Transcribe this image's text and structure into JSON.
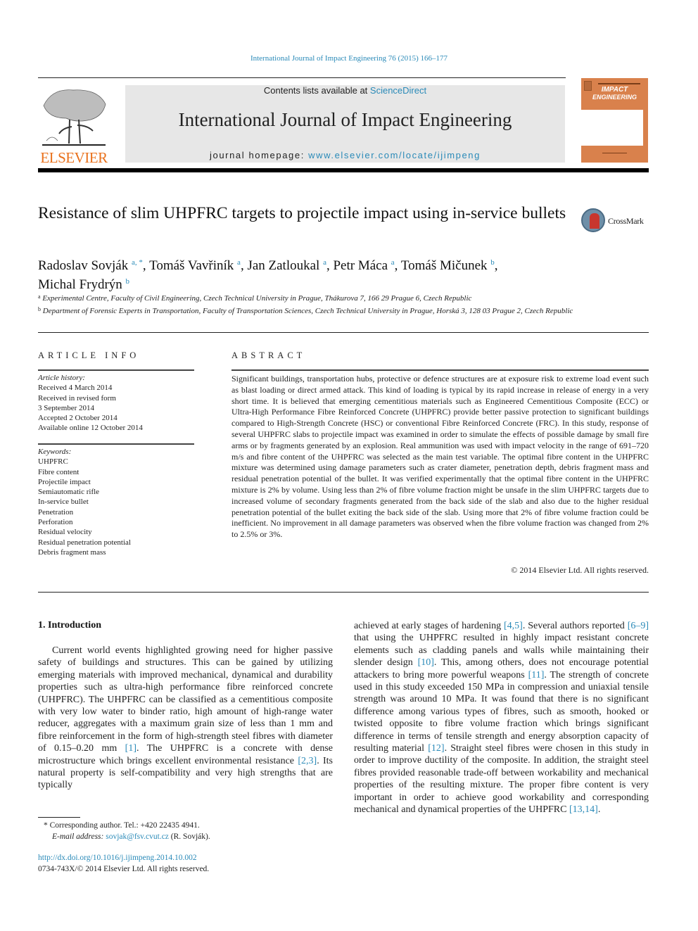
{
  "header": {
    "citation": "International Journal of Impact Engineering 76 (2015) 166–177",
    "publisher_logo_text": "ELSEVIER",
    "contents_prefix": "Contents lists available at ",
    "contents_link": "ScienceDirect",
    "journal_title": "International Journal of Impact Engineering",
    "homepage_prefix": "journal homepage: ",
    "homepage_link": "www.elsevier.com/locate/ijimpeng",
    "cover_title_1": "IMPACT",
    "cover_title_2": "ENGINEERING",
    "crossmark_label": "CrossMark"
  },
  "article": {
    "title": "Resistance of slim UHPFRC targets to projectile impact using in-service bullets",
    "authors": [
      {
        "name": "Radoslav Sovják",
        "aff": "a, *"
      },
      {
        "name": "Tomáš Vavřiník",
        "aff": "a"
      },
      {
        "name": "Jan Zatloukal",
        "aff": "a"
      },
      {
        "name": "Petr Máca",
        "aff": "a"
      },
      {
        "name": "Tomáš Mičunek",
        "aff": "b"
      },
      {
        "name": "Michal Frydrýn",
        "aff": "b"
      }
    ],
    "affiliations": [
      {
        "mark": "a",
        "text": "Experimental Centre, Faculty of Civil Engineering, Czech Technical University in Prague, Thákurova 7, 166 29 Prague 6, Czech Republic"
      },
      {
        "mark": "b",
        "text": "Department of Forensic Experts in Transportation, Faculty of Transportation Sciences, Czech Technical University in Prague, Horská 3, 128 03 Prague 2, Czech Republic"
      }
    ]
  },
  "article_info": {
    "heading": "ARTICLE INFO",
    "history_label": "Article history:",
    "history": [
      "Received 4 March 2014",
      "Received in revised form",
      "3 September 2014",
      "Accepted 2 October 2014",
      "Available online 12 October 2014"
    ],
    "keywords_label": "Keywords:",
    "keywords": [
      "UHPFRC",
      "Fibre content",
      "Projectile impact",
      "Semiautomatic rifle",
      "In-service bullet",
      "Penetration",
      "Perforation",
      "Residual velocity",
      "Residual penetration potential",
      "Debris fragment mass"
    ]
  },
  "abstract": {
    "heading": "ABSTRACT",
    "text": "Significant buildings, transportation hubs, protective or defence structures are at exposure risk to extreme load event such as blast loading or direct armed attack. This kind of loading is typical by its rapid increase in release of energy in a very short time. It is believed that emerging cementitious materials such as Engineered Cementitious Composite (ECC) or Ultra-High Performance Fibre Reinforced Concrete (UHPFRC) provide better passive protection to significant buildings compared to High-Strength Concrete (HSC) or conventional Fibre Reinforced Concrete (FRC). In this study, response of several UHPFRC slabs to projectile impact was examined in order to simulate the effects of possible damage by small fire arms or by fragments generated by an explosion. Real ammunition was used with impact velocity in the range of 691–720 m/s and fibre content of the UHPFRC was selected as the main test variable. The optimal fibre content in the UHPFRC mixture was determined using damage parameters such as crater diameter, penetration depth, debris fragment mass and residual penetration potential of the bullet. It was verified experimentally that the optimal fibre content in the UHPFRC mixture is 2% by volume. Using less than 2% of fibre volume fraction might be unsafe in the slim UHPFRC targets due to increased volume of secondary fragments generated from the back side of the slab and also due to the higher residual penetration potential of the bullet exiting the back side of the slab. Using more that 2% of fibre volume fraction could be inefficient. No improvement in all damage parameters was observed when the fibre volume fraction was changed from 2% to 2.5% or 3%.",
    "copyright": "© 2014 Elsevier Ltd. All rights reserved."
  },
  "intro": {
    "heading": "1.  Introduction",
    "left": [
      {
        "t": "Current world events highlighted growing need for higher passive safety of buildings and structures. This can be gained by utilizing emerging materials with improved mechanical, dynamical and durability properties such as ultra-high performance fibre reinforced concrete (UHPFRC). The UHPFRC can be classified as a cementitious composite with very low water to binder ratio, high amount of high-range water reducer, aggregates with a maximum grain size of less than 1 mm and fibre reinforcement in the form of high-strength steel fibres with diameter of 0.15–0.20 mm "
      },
      {
        "ref": "[1]"
      },
      {
        "t": ". The UHPFRC is a concrete with dense microstructure which brings excellent environmental resistance "
      },
      {
        "ref": "[2,3]"
      },
      {
        "t": ". Its natural property is self-compatibility and very high strengths that are typically"
      }
    ],
    "right": [
      {
        "t": "achieved at early stages of hardening "
      },
      {
        "ref": "[4,5]"
      },
      {
        "t": ". Several authors reported "
      },
      {
        "ref": "[6–9]"
      },
      {
        "t": " that using the UHPFRC resulted in highly impact resistant concrete elements such as cladding panels and walls while maintaining their slender design "
      },
      {
        "ref": "[10]"
      },
      {
        "t": ". This, among others, does not encourage potential attackers to bring more powerful weapons "
      },
      {
        "ref": "[11]"
      },
      {
        "t": ". The strength of concrete used in this study exceeded 150 MPa in compression and uniaxial tensile strength was around 10 MPa. It was found that there is no significant difference among various types of fibres, such as smooth, hooked or twisted opposite to fibre volume fraction which brings significant difference in terms of tensile strength and energy absorption capacity of resulting material "
      },
      {
        "ref": "[12]"
      },
      {
        "t": ". Straight steel fibres were chosen in this study in order to improve ductility of the composite. In addition, the straight steel fibres provided reasonable trade-off between workability and mechanical properties of the resulting mixture. The proper fibre content is very important in order to achieve good workability and corresponding mechanical and dynamical properties of the UHPFRC "
      },
      {
        "ref": "[13,14]"
      },
      {
        "t": "."
      }
    ]
  },
  "footnote": {
    "star_line": "* Corresponding author. Tel.: +420 22435 4941.",
    "email_label": "E-mail address: ",
    "email": "sovjak@fsv.cvut.cz",
    "email_suffix": " (R. Sovják).",
    "doi": "http://dx.doi.org/10.1016/j.ijimpeng.2014.10.002",
    "issn": "0734-743X/© 2014 Elsevier Ltd. All rights reserved."
  }
}
